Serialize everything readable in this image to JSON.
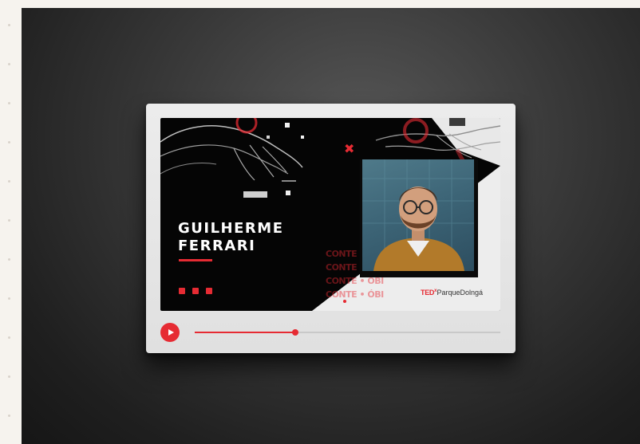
{
  "slide": {
    "speaker_first_name": "GUILHERME",
    "speaker_last_name": "FERRARI",
    "repeat_text_lines": [
      "CONTE • ÓBI",
      "CONTE • ÓBI",
      "CONTE • ÓBI",
      "CONTE • ÓBI"
    ],
    "logo": {
      "ted": "TED",
      "x": "x",
      "event": "ParqueDolngá"
    }
  },
  "player": {
    "progress": 0.33,
    "play_icon": "play-icon"
  },
  "colors": {
    "accent": "#e62b33",
    "screen_bg": "#050505",
    "card_bg": "#e6e6e6",
    "backdrop": "#2b2b2b",
    "page_bg": "#f6f3ee"
  }
}
